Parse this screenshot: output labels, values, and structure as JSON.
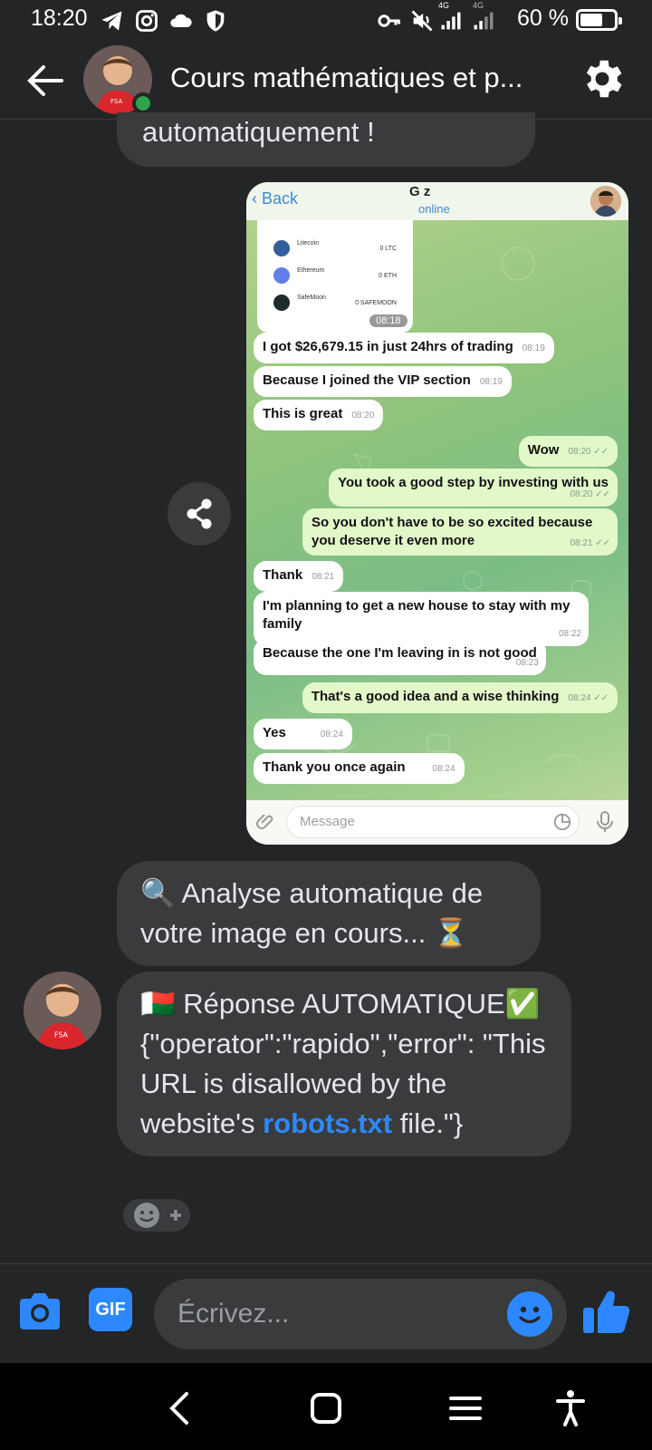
{
  "status_bar": {
    "time": "18:20",
    "battery": "60 %",
    "network_1": "4G",
    "network_2": "4G",
    "icons": [
      "telegram-icon",
      "instagram-icon",
      "cloud-icon",
      "shield-icon",
      "key-icon",
      "mute-icon",
      "signal-icon",
      "signal-icon",
      "battery-icon"
    ]
  },
  "header": {
    "title": "Cours mathématiques et p...",
    "online": true
  },
  "messages": {
    "top_partial": "automatiquement !",
    "analyse": "🔍 Analyse automatique de votre image en cours... ⏳",
    "reponse_prefix": "🇲🇬 Réponse AUTOMATIQUE✅ {\"operator\":\"rapido\",\"error\": \"This URL is disallowed by the website's ",
    "reponse_link": "robots.txt",
    "reponse_suffix": " file.\"}"
  },
  "shared_image": {
    "back": "Back",
    "name": "G     z",
    "status": "online",
    "wallet": [
      {
        "coin": "Litecoin",
        "amount": "0 LTC",
        "color": "#345d9d"
      },
      {
        "coin": "Ethereum",
        "amount": "0 ETH",
        "color": "#627eea"
      },
      {
        "coin": "SafeMoon",
        "amount": "0 SAFEMOON",
        "color": "#1f2a2a"
      }
    ],
    "wallet_time": "08:18",
    "chat": [
      {
        "text": "I got $26,679.15 in just 24hrs of trading",
        "time": "08:19",
        "dir": "in"
      },
      {
        "text": "Because I joined the VIP section",
        "time": "08:19",
        "dir": "in"
      },
      {
        "text": "This is great",
        "time": "08:20",
        "dir": "in"
      },
      {
        "text": "Wow",
        "time": "08:20 ✓✓",
        "dir": "out"
      },
      {
        "text": "You took a good step by investing with us",
        "time": "08:20 ✓✓",
        "dir": "out"
      },
      {
        "text": "So you don't have to be so excited because you deserve it even more",
        "time": "08:21 ✓✓",
        "dir": "out"
      },
      {
        "text": "Thank",
        "time": "08:21",
        "dir": "in"
      },
      {
        "text": "I'm planning to get a new house to stay with my family",
        "time": "08:22",
        "dir": "in"
      },
      {
        "text": "Because the one I'm leaving in is not good",
        "time": "08:23",
        "dir": "in"
      },
      {
        "text": "That's a good idea and a wise thinking",
        "time": "08:24 ✓✓",
        "dir": "out"
      },
      {
        "text": "Yes",
        "time": "08:24",
        "dir": "in"
      },
      {
        "text": "Thank you once again",
        "time": "08:24",
        "dir": "in"
      }
    ],
    "message_placeholder": "Message"
  },
  "composer": {
    "gif_label": "GIF",
    "placeholder": "Écrivez..."
  },
  "colors": {
    "accent": "#2d88ff",
    "background": "#242526",
    "bubble": "#3a3b3c",
    "online": "#31a24c"
  }
}
